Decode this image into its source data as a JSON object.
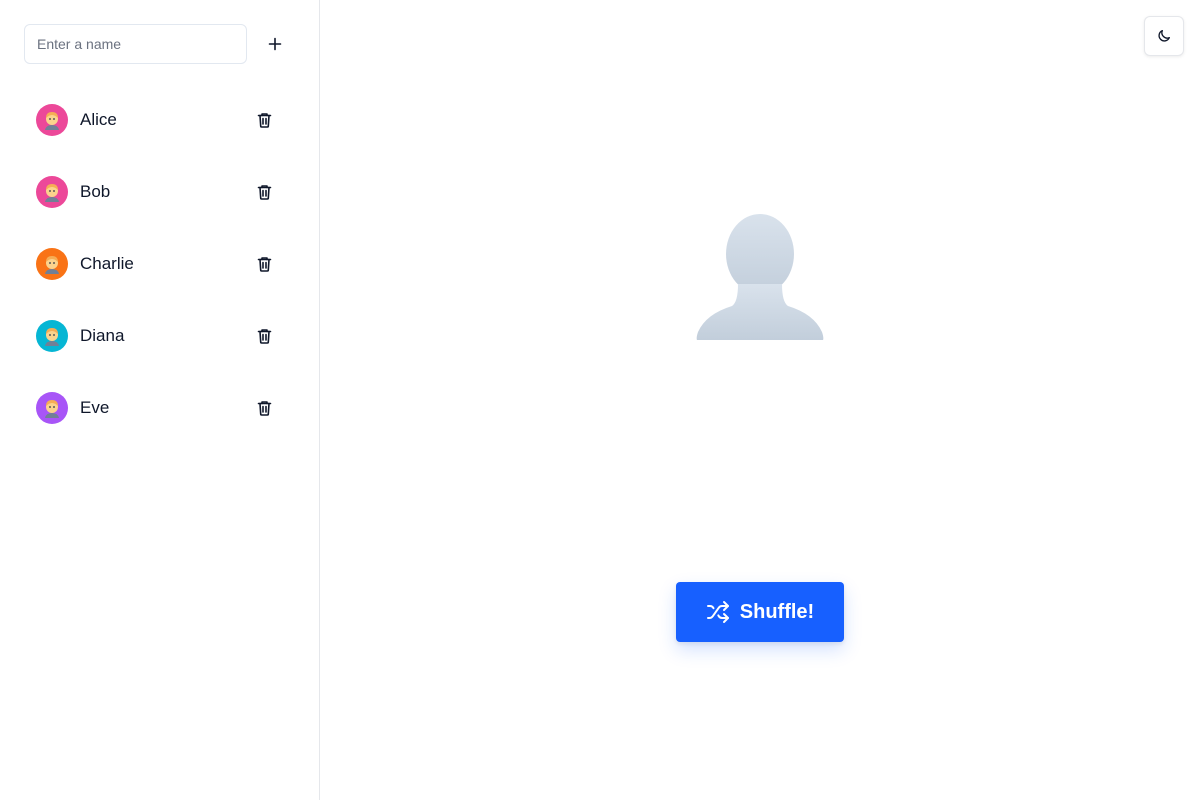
{
  "add_form": {
    "placeholder": "Enter a name",
    "value": "",
    "add_icon": "plus-icon"
  },
  "people": [
    {
      "name": "Alice",
      "avatar_color": "#ec4899",
      "avatar_icon": "person-emoji-icon"
    },
    {
      "name": "Bob",
      "avatar_color": "#ec4899",
      "avatar_icon": "person-emoji-icon"
    },
    {
      "name": "Charlie",
      "avatar_color": "#f97316",
      "avatar_icon": "person-emoji-icon"
    },
    {
      "name": "Diana",
      "avatar_color": "#06b6d4",
      "avatar_icon": "person-emoji-icon"
    },
    {
      "name": "Eve",
      "avatar_color": "#a855f7",
      "avatar_icon": "person-emoji-icon"
    }
  ],
  "delete_icon": "trash-icon",
  "theme_toggle_icon": "moon-icon",
  "shuffle": {
    "label": "Shuffle!",
    "icon": "shuffle-icon",
    "color": "#1760ff"
  }
}
